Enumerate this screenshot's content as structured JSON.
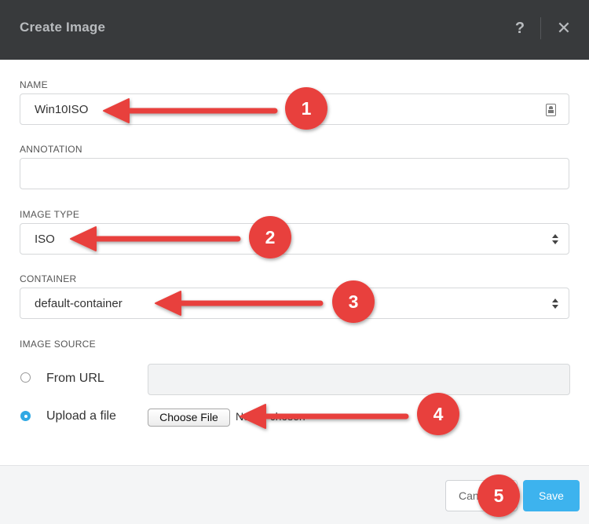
{
  "dialog": {
    "title": "Create Image",
    "help_glyph": "?",
    "close_glyph": "✕"
  },
  "form": {
    "name": {
      "label": "NAME",
      "value": "Win10ISO"
    },
    "annotation": {
      "label": "ANNOTATION",
      "value": ""
    },
    "image_type": {
      "label": "IMAGE TYPE",
      "value": "ISO"
    },
    "container": {
      "label": "CONTAINER",
      "value": "default-container"
    },
    "image_source": {
      "label": "IMAGE SOURCE",
      "from_url": {
        "label": "From URL",
        "selected": false,
        "value": ""
      },
      "upload_file": {
        "label": "Upload a file",
        "selected": true,
        "button_label": "Choose File",
        "status_text": "No file chosen"
      }
    }
  },
  "footer": {
    "cancel_label": "Cancel",
    "save_label": "Save"
  },
  "callouts": [
    "1",
    "2",
    "3",
    "4",
    "5"
  ],
  "colors": {
    "header_bg": "#383a3c",
    "accent": "#3db3ee",
    "callout_red": "#e8413c"
  }
}
